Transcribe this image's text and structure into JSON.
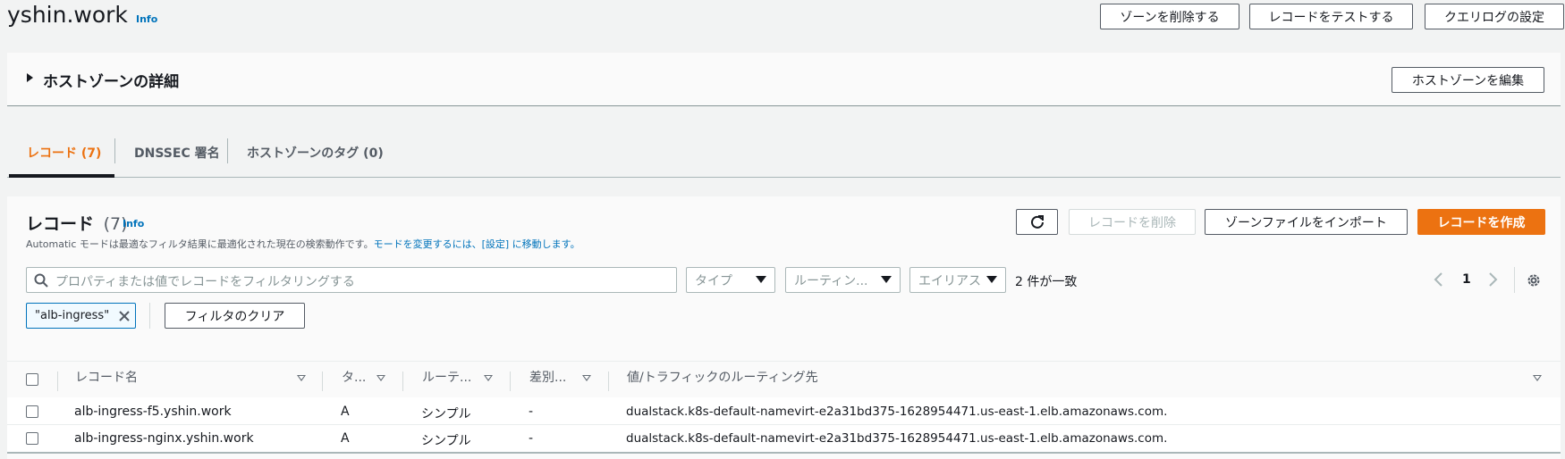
{
  "header": {
    "title": "yshin.work",
    "info": "Info",
    "buttons": {
      "delete_zone": "ゾーンを削除する",
      "test_record": "レコードをテストする",
      "query_log": "クエリログの設定"
    }
  },
  "details": {
    "title": "ホストゾーンの詳細",
    "edit_button": "ホストゾーンを編集"
  },
  "tabs": [
    {
      "label": "レコード (7)",
      "active": true
    },
    {
      "label": "DNSSEC 署名",
      "active": false
    },
    {
      "label": "ホストゾーンのタグ (0)",
      "active": false
    }
  ],
  "records": {
    "title": "レコード",
    "count": "(7)",
    "info": "Info",
    "description_prefix": "Automatic モードは最適なフィルタ結果に最適化された現在の検索動作です。",
    "description_link": "モードを変更するには、[設定] に移動します。",
    "buttons": {
      "delete": "レコードを削除",
      "import": "ゾーンファイルをインポート",
      "create": "レコードを作成"
    },
    "search_placeholder": "プロパティまたは値でレコードをフィルタリングする",
    "filters": {
      "type": "タイプ",
      "routing": "ルーティン...",
      "alias": "エイリアス"
    },
    "match_count": "2 件が一致",
    "page": "1",
    "token": "\"alb-ingress\"",
    "clear_filters": "フィルタのクリア",
    "columns": [
      "レコード名",
      "タ...",
      "ルーテ...",
      "差別...",
      "値/トラフィックのルーティング先"
    ],
    "rows": [
      {
        "name": "alb-ingress-f5.yshin.work",
        "type": "A",
        "routing": "シンプル",
        "diff": "-",
        "value": "dualstack.k8s-default-namevirt-e2a31bd375-1628954471.us-east-1.elb.amazonaws.com."
      },
      {
        "name": "alb-ingress-nginx.yshin.work",
        "type": "A",
        "routing": "シンプル",
        "diff": "-",
        "value": "dualstack.k8s-default-namevirt-e2a31bd375-1628954471.us-east-1.elb.amazonaws.com."
      }
    ]
  },
  "colors": {
    "accent": "#ec7211",
    "link": "#0073bb"
  }
}
